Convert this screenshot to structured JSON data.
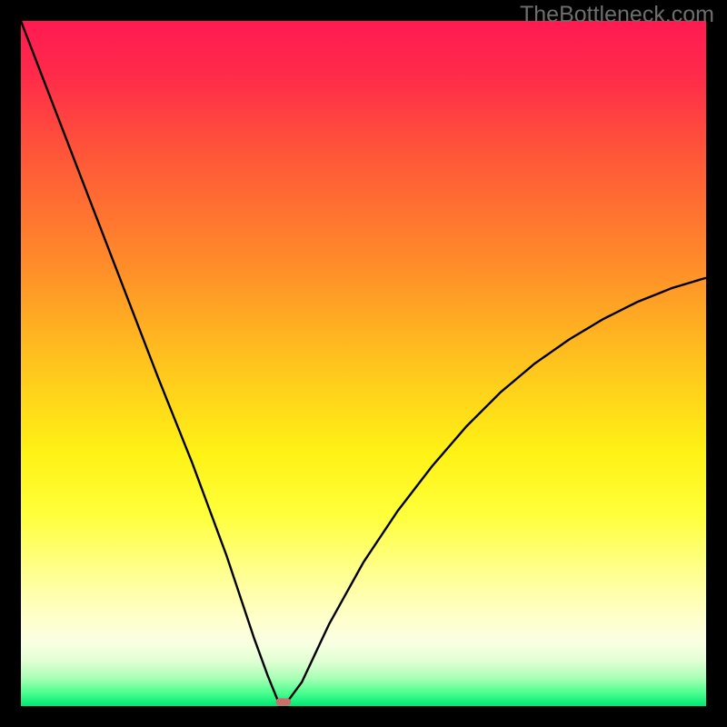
{
  "watermark": "TheBottleneck.com",
  "chart_data": {
    "type": "line",
    "title": "",
    "xlabel": "",
    "ylabel": "",
    "xlim": [
      0,
      100
    ],
    "ylim": [
      0,
      100
    ],
    "axes_visible": false,
    "background_gradient": {
      "stops": [
        {
          "pos": 0.0,
          "color": "#ff1a52"
        },
        {
          "pos": 0.08,
          "color": "#ff2b4a"
        },
        {
          "pos": 0.2,
          "color": "#ff5838"
        },
        {
          "pos": 0.35,
          "color": "#ff8a2a"
        },
        {
          "pos": 0.5,
          "color": "#ffc41e"
        },
        {
          "pos": 0.63,
          "color": "#fff215"
        },
        {
          "pos": 0.72,
          "color": "#ffff3a"
        },
        {
          "pos": 0.8,
          "color": "#ffff8a"
        },
        {
          "pos": 0.86,
          "color": "#ffffc2"
        },
        {
          "pos": 0.905,
          "color": "#fbffe2"
        },
        {
          "pos": 0.935,
          "color": "#e0ffd4"
        },
        {
          "pos": 0.96,
          "color": "#a6ffb4"
        },
        {
          "pos": 0.98,
          "color": "#4dff90"
        },
        {
          "pos": 1.0,
          "color": "#00e874"
        }
      ]
    },
    "curve_description": "V-shaped bottleneck curve: 100% at x=0, drops to 0% near x≈38, rises back toward ~62% at x=100",
    "series": [
      {
        "name": "bottleneck-curve",
        "color": "#000000",
        "x": [
          0,
          5,
          10,
          15,
          20,
          25,
          30,
          34,
          36,
          37.5,
          39,
          41,
          45,
          50,
          55,
          60,
          65,
          70,
          75,
          80,
          85,
          90,
          95,
          100
        ],
        "y": [
          100,
          87,
          74,
          61,
          48,
          35.5,
          22,
          10,
          4.5,
          0.8,
          0.8,
          3.5,
          12,
          21,
          28.5,
          35,
          40.8,
          45.8,
          50,
          53.5,
          56.5,
          59,
          61,
          62.5
        ]
      }
    ],
    "minimum_marker": {
      "shape": "pill",
      "color": "#cc6f6a",
      "x": 38.3,
      "y": 0.6,
      "width_pct": 2.2,
      "height_pct": 1.1
    }
  }
}
